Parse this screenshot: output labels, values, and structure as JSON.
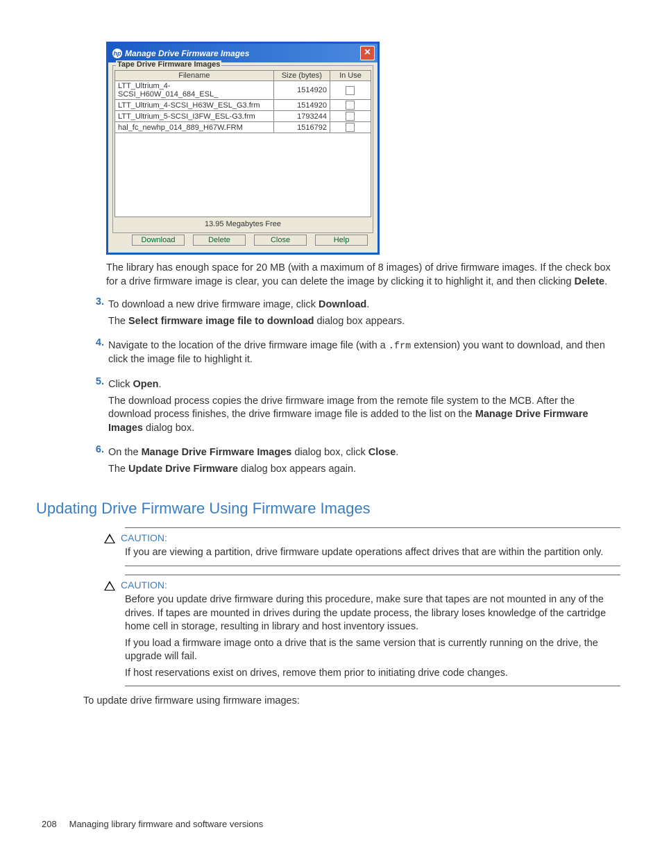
{
  "dialog": {
    "title": "Manage Drive Firmware Images",
    "fieldset_legend": "Tape Drive Firmware Images",
    "headers": {
      "filename": "Filename",
      "size": "Size (bytes)",
      "inuse": "In Use"
    },
    "rows": [
      {
        "filename": "LTT_Ultrium_4-SCSI_H60W_014_684_ESL_",
        "size": "1514920"
      },
      {
        "filename": "LTT_Ultrium_4-SCSI_H63W_ESL_G3.frm",
        "size": "1514920"
      },
      {
        "filename": "LTT_Ultrium_5-SCSI_I3FW_ESL-G3.frm",
        "size": "1793244"
      },
      {
        "filename": "hal_fc_newhp_014_889_H67W.FRM",
        "size": "1516792"
      }
    ],
    "freespace": "13.95 Megabytes Free",
    "buttons": {
      "download": "Download",
      "delete": "Delete",
      "close": "Close",
      "help": "Help"
    }
  },
  "para_after_dialog": {
    "l1": "The library has enough space for 20 MB (with a maximum of 8 images) of drive firmware images. If the check box for a drive firmware image is clear, you can delete the image by clicking it to highlight it, and then clicking ",
    "b1": "Delete",
    "l2": "."
  },
  "steps": {
    "s3": {
      "num": "3.",
      "a": "To download a new drive firmware image, click ",
      "b": "Download",
      "c": ".",
      "p2a": "The ",
      "p2b": "Select firmware image file to download",
      "p2c": " dialog box appears."
    },
    "s4": {
      "num": "4.",
      "a": "Navigate to the location of the drive firmware image file (with a ",
      "code": ".frm",
      "b": " extension) you want to download, and then click the image file to highlight it."
    },
    "s5": {
      "num": "5.",
      "a": "Click ",
      "b": "Open",
      "c": ".",
      "p2": "The download process copies the drive firmware image from the remote file system to the MCB. After the download process finishes, the drive firmware image file is added to the list on the ",
      "p2b": "Manage Drive Firmware Images",
      "p2c": " dialog box."
    },
    "s6": {
      "num": "6.",
      "a": "On the ",
      "b": "Manage Drive Firmware Images",
      "c": " dialog box, click ",
      "d": "Close",
      "e": ".",
      "p2a": "The ",
      "p2b": "Update Drive Firmware",
      "p2c": " dialog box appears again."
    }
  },
  "section_heading": "Updating Drive Firmware Using Firmware Images",
  "caution1": {
    "label": "CAUTION:",
    "text": "If you are viewing a partition, drive firmware update operations affect drives that are within the partition only."
  },
  "caution2": {
    "label": "CAUTION:",
    "p1": "Before you update drive firmware during this procedure, make sure that tapes are not mounted in any of the drives. If tapes are mounted in drives during the update process, the library loses knowledge of the cartridge home cell in storage, resulting in library and host inventory issues.",
    "p2": "If you load a firmware image onto a drive that is the same version that is currently running on the drive, the upgrade will fail.",
    "p3": "If host reservations exist on drives, remove them prior to initiating drive code changes."
  },
  "closing_para": "To update drive firmware using firmware images:",
  "footer": {
    "page": "208",
    "title": "Managing library firmware and software versions"
  }
}
